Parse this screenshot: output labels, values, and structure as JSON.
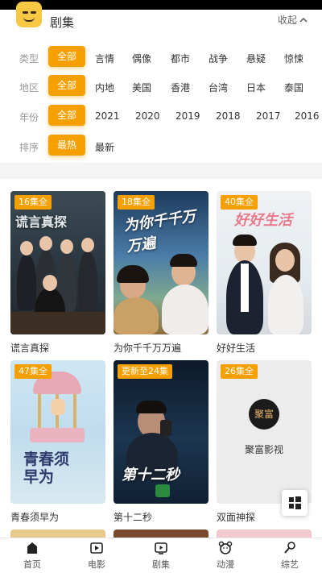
{
  "header": {
    "title": "剧集",
    "collapse_label": "收起"
  },
  "filters": {
    "rows": [
      {
        "label": "类型",
        "options": [
          "全部",
          "言情",
          "偶像",
          "都市",
          "战争",
          "悬疑",
          "惊悚"
        ],
        "active": 0
      },
      {
        "label": "地区",
        "options": [
          "全部",
          "内地",
          "美国",
          "香港",
          "台湾",
          "日本",
          "泰国"
        ],
        "active": 0
      },
      {
        "label": "年份",
        "options": [
          "全部",
          "2021",
          "2020",
          "2019",
          "2018",
          "2017",
          "2016"
        ],
        "active": 0
      },
      {
        "label": "排序",
        "options": [
          "最热",
          "最新"
        ],
        "active": 0
      }
    ]
  },
  "cards": [
    {
      "name": "谎言真探",
      "badge": "16集全",
      "poster_title": "谎言真探"
    },
    {
      "name": "为你千千万万遍",
      "badge": "18集全",
      "poster_title": "为你千千万万遍"
    },
    {
      "name": "好好生活",
      "badge": "40集全",
      "poster_title": "好好生活"
    },
    {
      "name": "青春须早为",
      "badge": "47集全",
      "poster_title": "青春须早为"
    },
    {
      "name": "第十二秒",
      "badge": "更新至24集",
      "poster_title": "第十二秒"
    },
    {
      "name": "双面神探",
      "badge": "26集全",
      "poster_title": ""
    }
  ],
  "placeholder": {
    "logo_text": "聚富",
    "name": "聚富影视"
  },
  "tabbar": {
    "items": [
      "首页",
      "电影",
      "剧集",
      "动漫",
      "综艺"
    ]
  },
  "colors": {
    "accent": "#f5a000",
    "background": "#f5f5f5"
  }
}
